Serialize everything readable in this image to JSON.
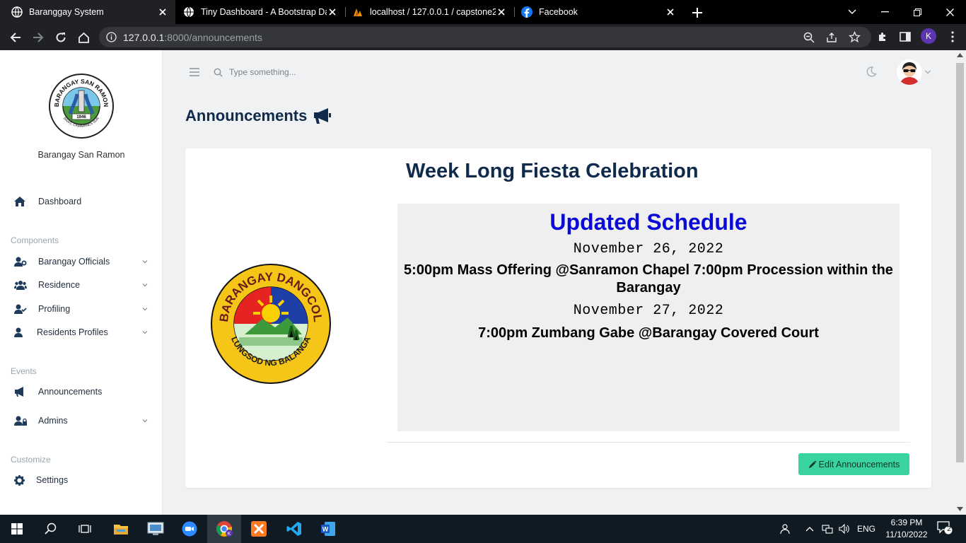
{
  "browser": {
    "tabs": [
      {
        "title": "Baranggay System",
        "active": true
      },
      {
        "title": "Tiny Dashboard - A Bootstrap Da",
        "active": false
      },
      {
        "title": "localhost / 127.0.0.1 / capstone2",
        "active": false
      },
      {
        "title": "Facebook",
        "active": false
      }
    ],
    "url_host": "127.0.0.1",
    "url_path": ":8000/announcements",
    "profile_initial": "K"
  },
  "sidebar": {
    "brand": "Barangay San Ramon",
    "dashboard": "Dashboard",
    "sections": {
      "components": "Components",
      "events": "Events",
      "customize": "Customize"
    },
    "items": {
      "officials": "Barangay Officials",
      "residence": "Residence",
      "profiling": "Profiling",
      "residents_profiles": "Residents Profiles",
      "announcements": "Announcements",
      "admins": "Admins",
      "settings": "Settings"
    },
    "logo_text": {
      "top": "BARANGAY SAN RAMON",
      "year": "1946",
      "bottom": "BAAO, CAMARINES SUR"
    }
  },
  "topbar": {
    "search_placeholder": "Type something..."
  },
  "page": {
    "title": "Announcements"
  },
  "announcement": {
    "title": "Week Long Fiesta Celebration",
    "heading": "Updated Schedule",
    "date1": "November 26, 2022",
    "event1": "5:00pm Mass Offering @Sanramon Chapel 7:00pm Procession within the Barangay",
    "date2": "November 27, 2022",
    "event2": "7:00pm Zumbang Gabe @Barangay Covered Court",
    "logo_text": {
      "top": "BARANGAY DANGCOL",
      "bottom": "LUNGSOD NG BALANGA"
    },
    "edit_label": "Edit Announcements"
  },
  "taskbar": {
    "lang": "ENG",
    "time": "6:39 PM",
    "date": "11/10/2022",
    "notifications": "2"
  },
  "colors": {
    "accent_green": "#3ad29f",
    "heading_blue": "#0b0bd6",
    "navy": "#0f2a4a"
  }
}
